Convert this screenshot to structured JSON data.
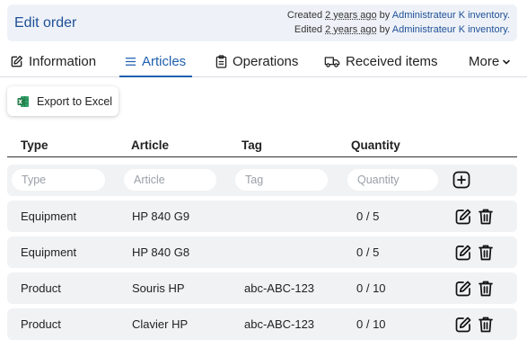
{
  "header": {
    "title": "Edit order",
    "created_prefix": "Created",
    "created_when": "2 years ago",
    "created_by": "by",
    "created_user": "Administrateur K inventory.",
    "edited_prefix": "Edited",
    "edited_when": "2 years ago",
    "edited_by": "by",
    "edited_user": "Administrateur K inventory."
  },
  "tabs": [
    {
      "label": "Information",
      "icon": "edit-icon",
      "active": false
    },
    {
      "label": "Articles",
      "icon": "list-icon",
      "active": true
    },
    {
      "label": "Operations",
      "icon": "clipboard-icon",
      "active": false
    },
    {
      "label": "Received items",
      "icon": "truck-icon",
      "active": false
    },
    {
      "label": "More",
      "icon": "chevron-down-icon",
      "active": false
    }
  ],
  "toolbar": {
    "export_label": "Export to Excel",
    "export_icon": "excel-icon"
  },
  "table": {
    "columns": [
      "Type",
      "Article",
      "Tag",
      "Quantity"
    ],
    "filters": {
      "type_placeholder": "Type",
      "article_placeholder": "Article",
      "tag_placeholder": "Tag",
      "quantity_placeholder": "Quantity"
    },
    "rows": [
      {
        "type": "Equipment",
        "article": "HP 840 G9",
        "tag": "",
        "quantity": "0 / 5"
      },
      {
        "type": "Equipment",
        "article": "HP 840 G8",
        "tag": "",
        "quantity": "0 / 5"
      },
      {
        "type": "Product",
        "article": "Souris HP",
        "tag": "abc-ABC-123",
        "quantity": "0 / 10"
      },
      {
        "type": "Product",
        "article": "Clavier HP",
        "tag": "abc-ABC-123",
        "quantity": "0 / 10"
      }
    ]
  },
  "colors": {
    "accent": "#1f5fae",
    "title": "#1f4f96",
    "header_bg": "#eef2f8",
    "row_bg": "#f1f2f4",
    "excel_green": "#1d7a45"
  }
}
